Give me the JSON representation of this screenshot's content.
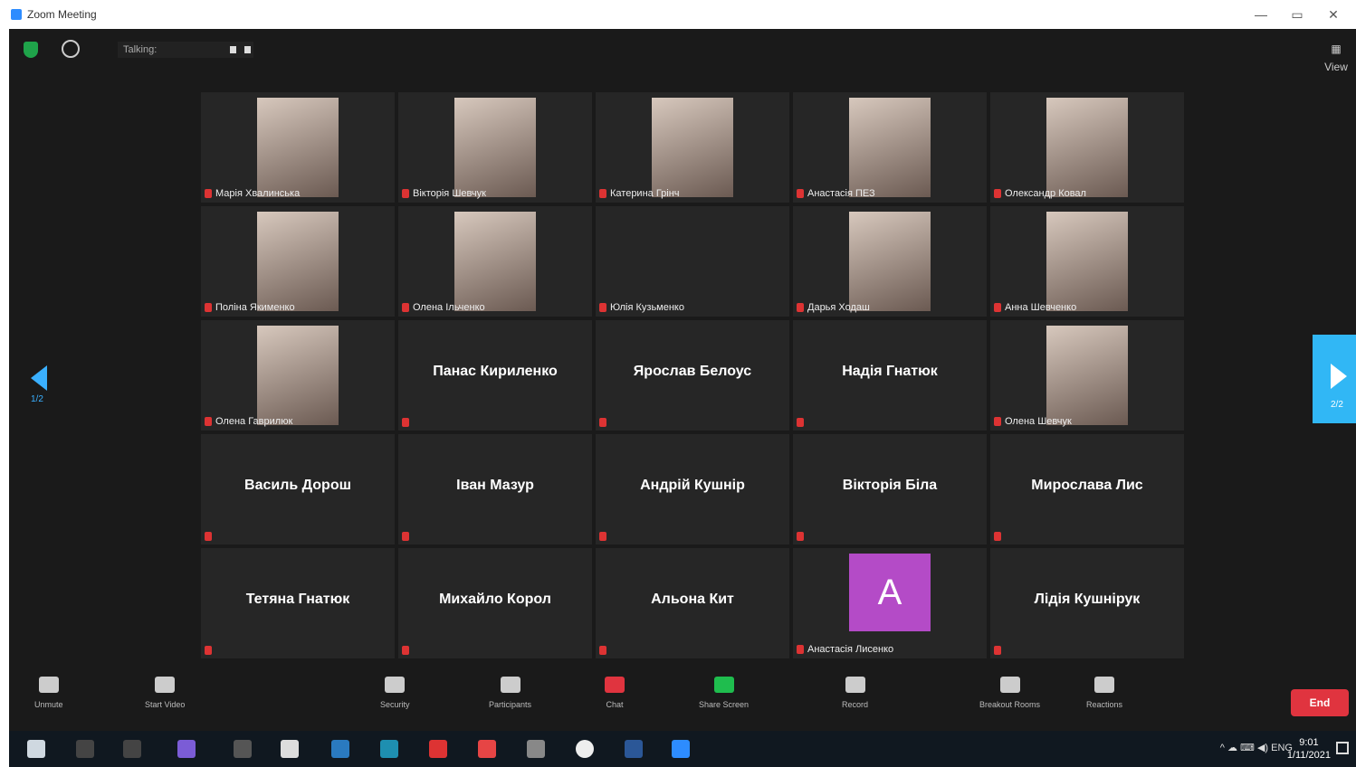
{
  "window": {
    "title": "Zoom Meeting",
    "minimize": "—",
    "maximize": "▭",
    "close": "✕"
  },
  "topbar": {
    "speaker_label": "Talking:",
    "view_label": "▦ View"
  },
  "tiles": [
    {
      "name": "Марія Хвалинська",
      "photo": true
    },
    {
      "name": "Вікторія Шевчук",
      "photo": true
    },
    {
      "name": "Катерина Грінч",
      "photo": true
    },
    {
      "name": "Анастасія ПЕЗ",
      "photo": true
    },
    {
      "name": "Олександр Ковал",
      "photo": true
    },
    {
      "name": "Поліна Якименко",
      "photo": true
    },
    {
      "name": "Олена Ільченко",
      "photo": true
    },
    {
      "name": "Юлія Кузьменко",
      "photo": false,
      "center": ""
    },
    {
      "name": "Дарья Ходаш",
      "photo": true
    },
    {
      "name": "Анна Шевченко",
      "photo": true
    },
    {
      "name": "Олена Гаврилюк",
      "photo": true
    },
    {
      "name": "",
      "photo": false,
      "center": "Панас Кириленко"
    },
    {
      "name": "",
      "photo": false,
      "center": "Ярослав Белоус"
    },
    {
      "name": "",
      "photo": false,
      "center": "Надія Гнатюк"
    },
    {
      "name": "Олена Шевчук",
      "photo": true
    },
    {
      "name": "",
      "photo": false,
      "center": "Василь Дорош"
    },
    {
      "name": "",
      "photo": false,
      "center": "Іван Мазур"
    },
    {
      "name": "",
      "photo": false,
      "center": "Андрій Кушнір"
    },
    {
      "name": "",
      "photo": false,
      "center": "Вікторія Біла"
    },
    {
      "name": "",
      "photo": false,
      "center": "Мирослава Лис"
    },
    {
      "name": "",
      "photo": false,
      "center": "Тетяна Гнатюк"
    },
    {
      "name": "",
      "photo": false,
      "center": "Михайло Корол"
    },
    {
      "name": "",
      "photo": false,
      "center": "Альона Кит"
    },
    {
      "name": "Анастасія Лисенко",
      "photo": false,
      "avatar": "A"
    },
    {
      "name": "",
      "photo": false,
      "center": "Лідія Кушнірук"
    }
  ],
  "pages": {
    "left": "1/2",
    "right": "2/2"
  },
  "toolbar": {
    "items": [
      {
        "label": "Unmute"
      },
      {
        "label": "Start Video"
      },
      {
        "label": "Security"
      },
      {
        "label": "Participants"
      },
      {
        "label": "Chat"
      },
      {
        "label": "Share Screen"
      },
      {
        "label": "Record"
      },
      {
        "label": "Breakout Rooms"
      },
      {
        "label": "Reactions"
      }
    ],
    "end": "End"
  },
  "taskbar": {
    "tray": "^ ☁ ⌨ ◀) ENG",
    "time": "9:01",
    "date": "1/11/2021"
  },
  "colors": {
    "background": "#1a1a1a",
    "tile": "#262626",
    "accent": "#31b7f5",
    "end": "#e0343f",
    "share": "#1fbd4e",
    "avatar": "#b44bc7"
  }
}
